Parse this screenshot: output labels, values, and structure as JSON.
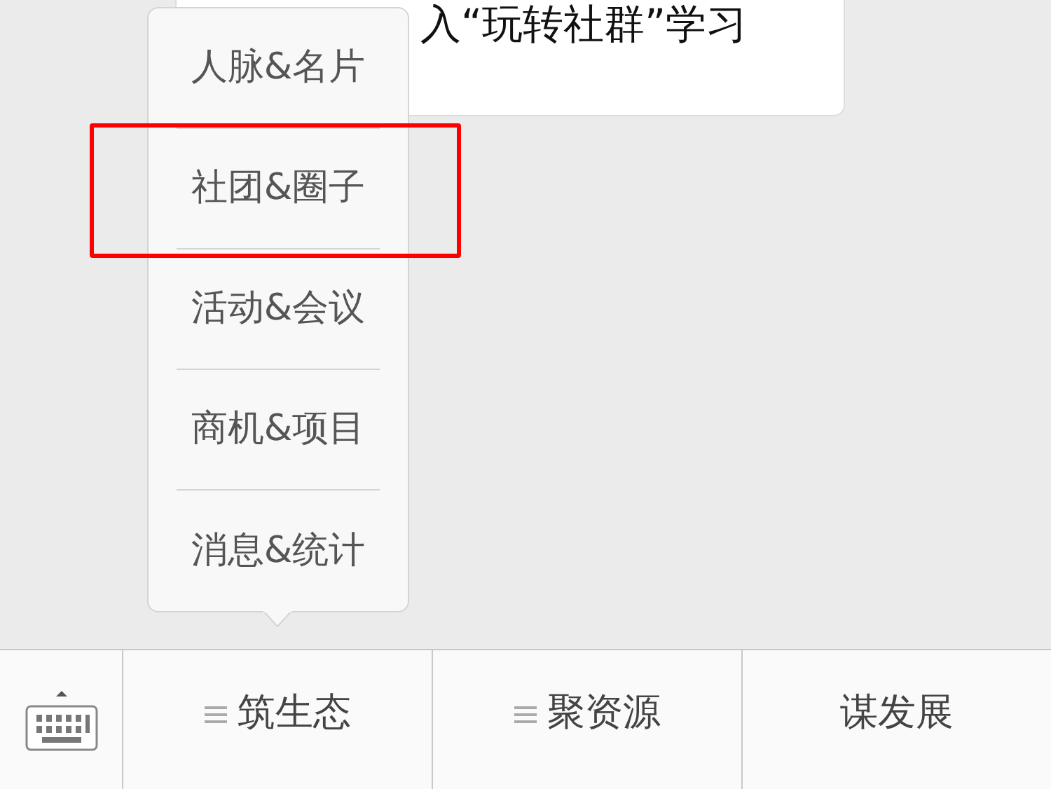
{
  "message": {
    "text": "入“玩转社群”学习"
  },
  "popup_menu": {
    "items": [
      {
        "label": "人脉&名片",
        "highlighted": false
      },
      {
        "label": "社团&圈子",
        "highlighted": true
      },
      {
        "label": "活动&会议",
        "highlighted": false
      },
      {
        "label": "商机&项目",
        "highlighted": false
      },
      {
        "label": "消息&统计",
        "highlighted": false
      }
    ]
  },
  "menu_bar": {
    "items": [
      {
        "label": "筑生态",
        "has_submenu": true
      },
      {
        "label": "聚资源",
        "has_submenu": true
      },
      {
        "label": "谋发展",
        "has_submenu": false
      }
    ]
  }
}
